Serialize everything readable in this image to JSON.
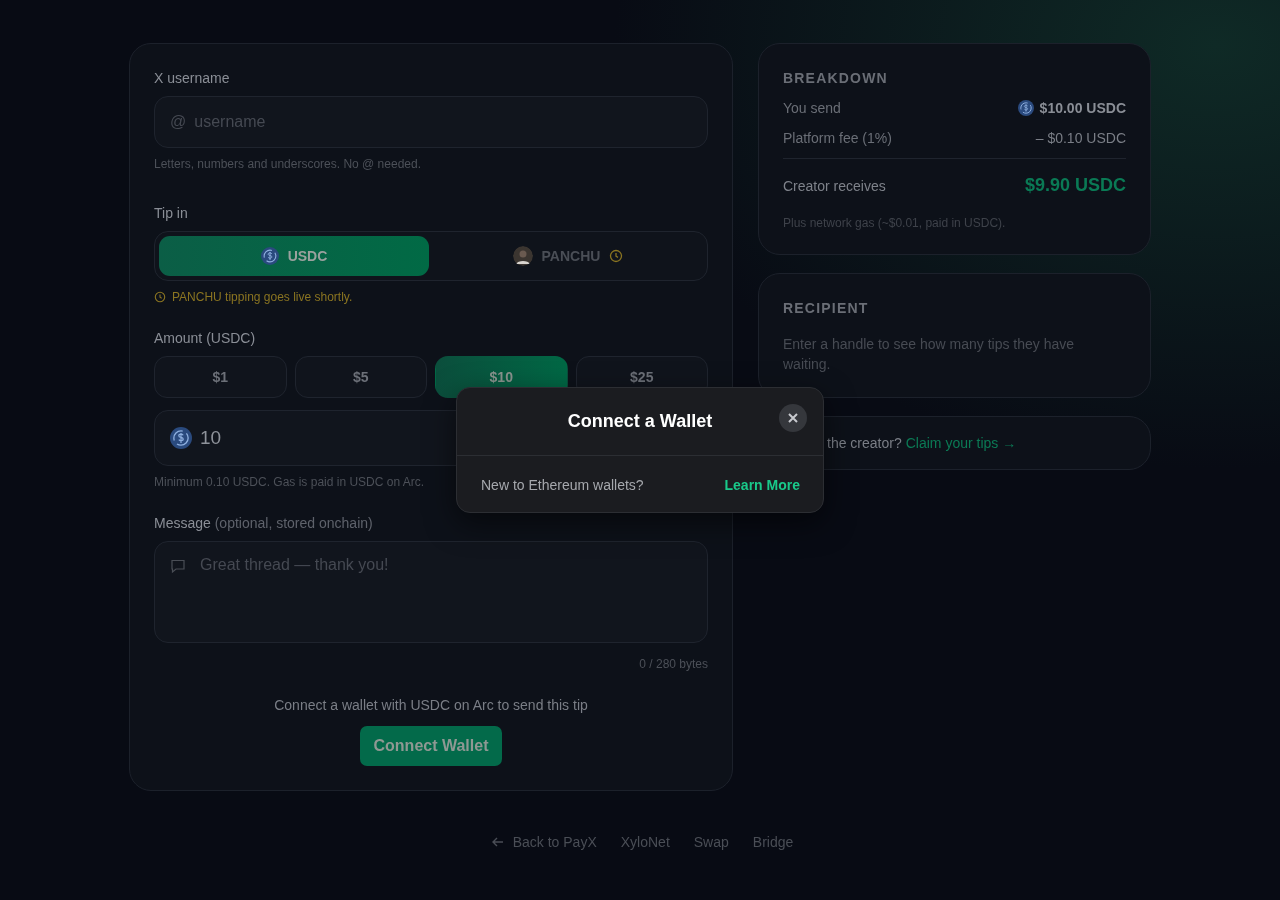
{
  "form": {
    "username": {
      "label": "X username",
      "prefix": "@",
      "placeholder": "username",
      "hint": "Letters, numbers and underscores. No @ needed."
    },
    "tip_in": {
      "label": "Tip in",
      "options": [
        {
          "label": "USDC",
          "kind": "coin",
          "selected": true,
          "pending": false
        },
        {
          "label": "PANCHU",
          "kind": "avatar",
          "selected": false,
          "pending": true
        }
      ],
      "notice": "PANCHU tipping goes live shortly."
    },
    "amount": {
      "label": "Amount (USDC)",
      "presets": [
        {
          "label": "$1",
          "selected": false
        },
        {
          "label": "$5",
          "selected": false
        },
        {
          "label": "$10",
          "selected": true
        },
        {
          "label": "$25",
          "selected": false
        }
      ],
      "value": "10",
      "hint": "Minimum 0.10 USDC. Gas is paid in USDC on Arc."
    },
    "message": {
      "label": "Message",
      "label_note": "(optional, stored onchain)",
      "placeholder": "Great thread — thank you!",
      "counter": "0 / 280 bytes"
    },
    "connect_prompt": "Connect a wallet with USDC on Arc to send this tip",
    "connect_button": "Connect Wallet"
  },
  "breakdown": {
    "title": "BREAKDOWN",
    "rows": [
      {
        "label": "You send",
        "value": "$10.00 USDC",
        "kind": "send"
      },
      {
        "label": "Platform fee (1%)",
        "value": "– $0.10 USDC",
        "kind": "fee"
      },
      {
        "label": "Creator receives",
        "value": "$9.90 USDC",
        "kind": "total"
      }
    ],
    "note": "Plus network gas (~$0.01, paid in USDC)."
  },
  "recipient": {
    "title": "RECIPIENT",
    "text": "Enter a handle to see how many tips they have waiting."
  },
  "claim": {
    "text": "the creator?",
    "link": "Claim your tips →"
  },
  "footer": {
    "back": "Back to PayX",
    "links": [
      "XyloNet",
      "Swap",
      "Bridge"
    ]
  },
  "modal": {
    "title": "Connect a Wallet",
    "text": "New to Ethereum wallets?",
    "link": "Learn More"
  }
}
